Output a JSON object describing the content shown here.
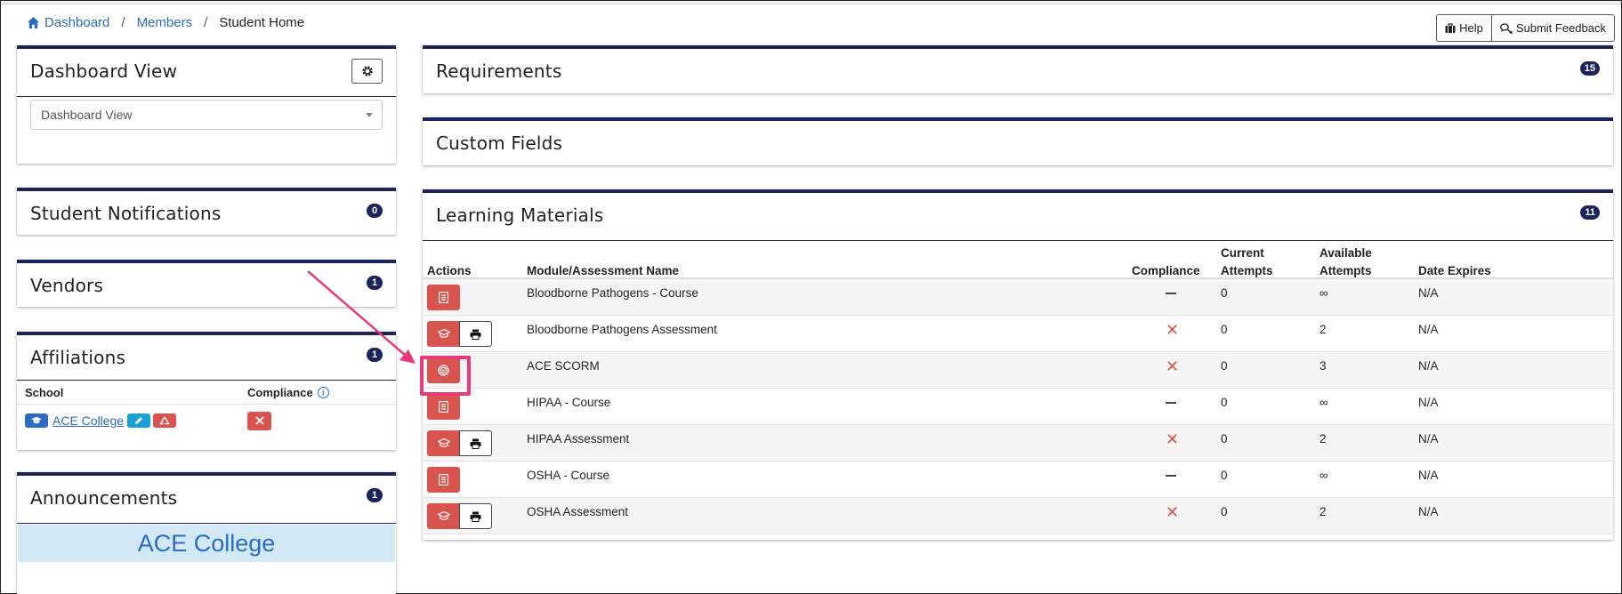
{
  "breadcrumb": {
    "items": [
      "Dashboard",
      "Members"
    ],
    "current": "Student Home",
    "separator": "/"
  },
  "top_buttons": {
    "help": "Help",
    "feedback": "Submit Feedback"
  },
  "dashboard_view": {
    "title": "Dashboard View",
    "select_value": "Dashboard View"
  },
  "student_notifications": {
    "title": "Student Notifications",
    "count": "0"
  },
  "vendors": {
    "title": "Vendors",
    "count": "1"
  },
  "affiliations": {
    "title": "Affiliations",
    "count": "1",
    "headers": {
      "school": "School",
      "compliance": "Compliance"
    },
    "rows": [
      {
        "school": "ACE College"
      }
    ]
  },
  "announcements": {
    "title": "Announcements",
    "count": "1",
    "banner": "ACE College"
  },
  "requirements": {
    "title": "Requirements",
    "count": "15"
  },
  "custom_fields": {
    "title": "Custom Fields"
  },
  "learning_materials": {
    "title": "Learning Materials",
    "count": "11",
    "headers": {
      "actions": "Actions",
      "name": "Module/Assessment Name",
      "compliance": "Compliance",
      "current_attempts_1": "Current",
      "current_attempts_2": "Attempts",
      "available_attempts_1": "Available",
      "available_attempts_2": "Attempts",
      "date_expires": "Date Expires"
    },
    "rows": [
      {
        "name": "Bloodborne Pathogens - Course",
        "compliance": "dash",
        "current": "0",
        "available": "∞",
        "expires": "N/A",
        "action": "book"
      },
      {
        "name": "Bloodborne Pathogens Assessment",
        "compliance": "x",
        "current": "0",
        "available": "2",
        "expires": "N/A",
        "action": "cap-print"
      },
      {
        "name": "ACE SCORM",
        "compliance": "x",
        "current": "0",
        "available": "3",
        "expires": "N/A",
        "action": "target"
      },
      {
        "name": "HIPAA - Course",
        "compliance": "dash",
        "current": "0",
        "available": "∞",
        "expires": "N/A",
        "action": "book"
      },
      {
        "name": "HIPAA Assessment",
        "compliance": "x",
        "current": "0",
        "available": "2",
        "expires": "N/A",
        "action": "cap-print"
      },
      {
        "name": "OSHA - Course",
        "compliance": "dash",
        "current": "0",
        "available": "∞",
        "expires": "N/A",
        "action": "book"
      },
      {
        "name": "OSHA Assessment",
        "compliance": "x",
        "current": "0",
        "available": "2",
        "expires": "N/A",
        "action": "cap-print"
      }
    ]
  },
  "colors": {
    "navy": "#1c2559",
    "link_blue": "#2a6cc1",
    "danger_red": "#d9534f",
    "highlight_pink": "#e8397a"
  }
}
